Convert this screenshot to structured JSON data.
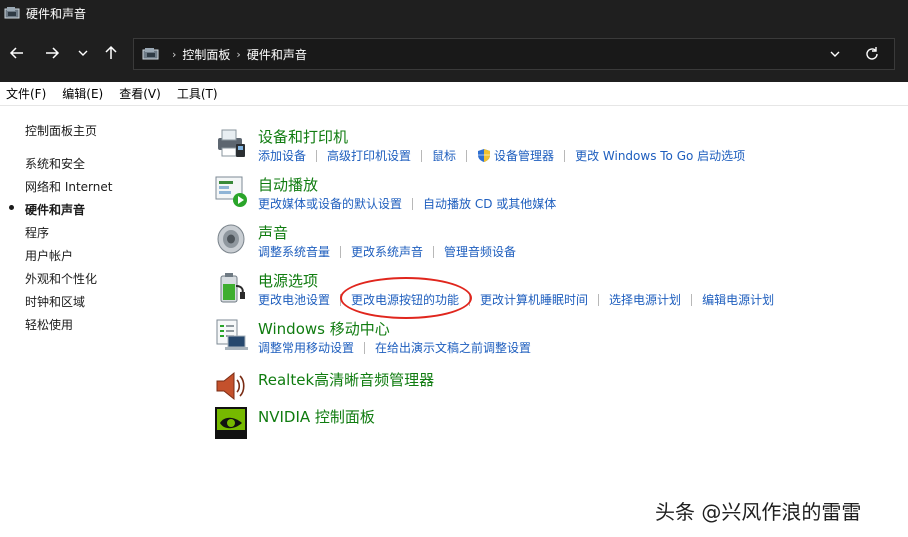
{
  "window": {
    "title": "硬件和声音"
  },
  "address_bar": {
    "crumbs": [
      "控制面板",
      "硬件和声音"
    ]
  },
  "menu": [
    "文件(F)",
    "编辑(E)",
    "查看(V)",
    "工具(T)"
  ],
  "sidebar": {
    "items": [
      {
        "label": "控制面板主页"
      },
      {
        "label": "系统和安全"
      },
      {
        "label": "网络和 Internet"
      },
      {
        "label": "硬件和声音",
        "active": true
      },
      {
        "label": "程序"
      },
      {
        "label": "用户帐户"
      },
      {
        "label": "外观和个性化"
      },
      {
        "label": "时钟和区域"
      },
      {
        "label": "轻松使用"
      }
    ]
  },
  "categories": [
    {
      "title": "设备和打印机",
      "icon": "printer-icon",
      "links": [
        "添加设备",
        "高级打印机设置",
        "鼠标",
        "设备管理器",
        "更改 Windows To Go 启动选项"
      ]
    },
    {
      "title": "自动播放",
      "icon": "autoplay-icon",
      "links": [
        "更改媒体或设备的默认设置",
        "自动播放 CD 或其他媒体"
      ]
    },
    {
      "title": "声音",
      "icon": "speaker-icon",
      "links": [
        "调整系统音量",
        "更改系统声音",
        "管理音频设备"
      ]
    },
    {
      "title": "电源选项",
      "icon": "battery-icon",
      "links": [
        "更改电池设置",
        "更改电源按钮的功能",
        "更改计算机睡眠时间",
        "选择电源计划",
        "编辑电源计划"
      ]
    },
    {
      "title": "Windows 移动中心",
      "icon": "mobility-center-icon",
      "links": [
        "调整常用移动设置",
        "在给出演示文稿之前调整设置"
      ]
    },
    {
      "title": "Realtek高清晰音频管理器",
      "icon": "realtek-speaker-icon",
      "links": []
    },
    {
      "title": "NVIDIA 控制面板",
      "icon": "nvidia-icon",
      "links": []
    }
  ],
  "watermark": "头条 @兴风作浪的雷雷",
  "colors": {
    "title_bar": "#1f1f1f",
    "category_title": "#107c10",
    "link": "#1e5ebe",
    "highlight_circle": "#e0261d"
  }
}
